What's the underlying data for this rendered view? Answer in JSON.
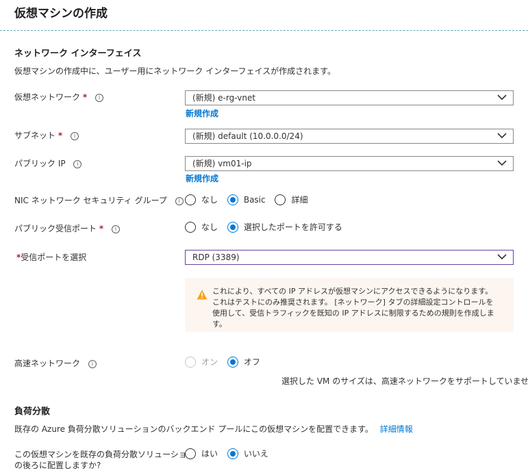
{
  "page": {
    "title": "仮想マシンの作成"
  },
  "network_interface": {
    "heading": "ネットワーク インターフェイス",
    "description": "仮想マシンの作成中に、ユーザー用にネットワーク インターフェイスが作成されます。"
  },
  "fields": {
    "vnet": {
      "label": "仮想ネットワーク",
      "value": "(新規) e-rg-vnet",
      "create_link": "新規作成"
    },
    "subnet": {
      "label": "サブネット",
      "value": "(新規) default (10.0.0.0/24)"
    },
    "public_ip": {
      "label": "パブリック IP",
      "value": "(新規) vm01-ip",
      "create_link": "新規作成"
    },
    "nic_nsg": {
      "label": "NIC ネットワーク セキュリティ グループ",
      "options": [
        "なし",
        "Basic",
        "詳細"
      ],
      "selected": "Basic"
    },
    "inbound_ports": {
      "label": "パブリック受信ポート",
      "options": [
        "なし",
        "選択したポートを許可する"
      ],
      "selected": "選択したポートを許可する"
    },
    "select_ports": {
      "label": "受信ポートを選択",
      "value": "RDP (3389)"
    },
    "accelerated": {
      "label": "高速ネットワーク",
      "options": [
        "オン",
        "オフ"
      ],
      "selected": "オフ",
      "note": "選択した VM のサイズは、高速ネットワークをサポートしていません。"
    }
  },
  "warning": {
    "icon": "warning-icon",
    "text": "これにより、すべての IP アドレスが仮想マシンにアクセスできるようになります。 これはテストにのみ推奨されます。 [ネットワーク] タブの詳細設定コントロールを使用して、受信トラフィックを既知の IP アドレスに制限するための規則を作成します。"
  },
  "load_balancing": {
    "heading": "負荷分散",
    "description": "既存の Azure 負荷分散ソリューションのバックエンド プールにこの仮想マシンを配置できます。",
    "learn_more": "詳細情報",
    "question_line1": "この仮想マシンを既存の負荷分散ソリューション",
    "question_line2": "の後ろに配置しますか?",
    "options": [
      "はい",
      "いいえ"
    ],
    "selected": "いいえ"
  },
  "colors": {
    "accent": "#0078d4",
    "required": "#a4262c",
    "warning": "#f7a11a",
    "warning_bg": "#fdf6f0",
    "focus_border": "#6b3fa0"
  }
}
